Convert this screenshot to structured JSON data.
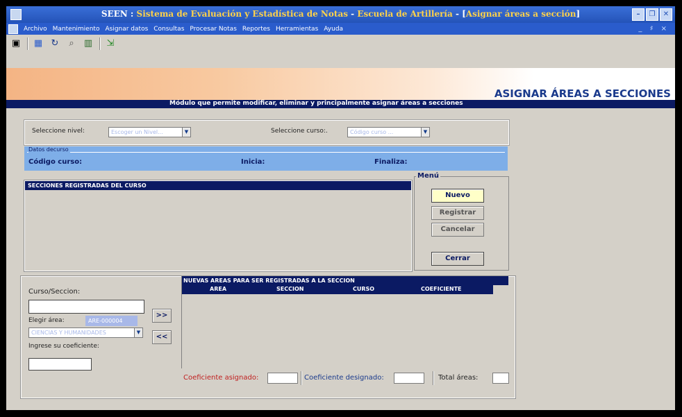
{
  "window": {
    "title_parts": [
      "SEEN : ",
      "Sistema de Evaluación y Estadística de Notas",
      " - ",
      "Escuela de Artillería",
      "   - [",
      "Asignar áreas a sección",
      "]"
    ],
    "controls": [
      "minimize-icon",
      "restore-icon",
      "close-icon"
    ]
  },
  "menubar": {
    "items": [
      "Archivo",
      "Mantenimiento",
      "Asignar datos",
      "Consultas",
      "Procesar Notas",
      "Reportes",
      "Herramientas",
      "Ayuda"
    ],
    "mdi_controls": "_ ♯ ×"
  },
  "toolbar": {
    "icons": [
      "window-icon",
      "calculator-icon",
      "refresh-icon",
      "search-icon",
      "books-icon",
      "exit-icon"
    ]
  },
  "banner": {
    "heading": "ASIGNAR ÁREAS A SECCIONES",
    "subtitle": "Módulo que permite modificar, eliminar y principalmente asignar áreas a secciones"
  },
  "selection": {
    "nivel_label": "Seleccione nivel:",
    "nivel_value": "Escoger un Nivel...",
    "curso_label": "Seleccione curso:.",
    "curso_value": "Código curso ..."
  },
  "datos_curso": {
    "caption": "Datos decurso",
    "codigo_label": "Código curso:",
    "inicia_label": "Inicia:",
    "finaliza_label": "Finaliza:"
  },
  "secciones": {
    "header": "SECCIONES REGISTRADAS DEL CURSO"
  },
  "menu": {
    "legend": "Menú",
    "nuevo": "Nuevo",
    "registrar": "Registrar",
    "cancelar": "Cancelar",
    "cerrar": "Cerrar"
  },
  "asignacion": {
    "curso_seccion_label": "Curso/Seccion:",
    "elegir_area_label": "Elegir  área:",
    "area_code": "ARE-000004",
    "area_value": "CIENCIAS Y HUMANIDADES",
    "coeficiente_label": "Ingrese su coeficiente:",
    "add_label": ">>",
    "remove_label": "<<"
  },
  "nuevas_areas": {
    "title": "NUEVAS AREAS PARA SER REGISTRADAS A LA SECCION",
    "columns": [
      "AREA",
      "SECCION",
      "CURSO",
      "COEFICIENTE"
    ]
  },
  "footer": {
    "coef_asignado_label": "Coeficiente asignado:",
    "coef_designado_label": "Coeficiente designado:",
    "total_areas_label": "Total áreas:"
  },
  "colors": {
    "accent_navy": "#0b1a63",
    "heading_blue": "#1a3a8c",
    "asignado_red": "#c02020",
    "designado_blue": "#1a3a8c"
  }
}
